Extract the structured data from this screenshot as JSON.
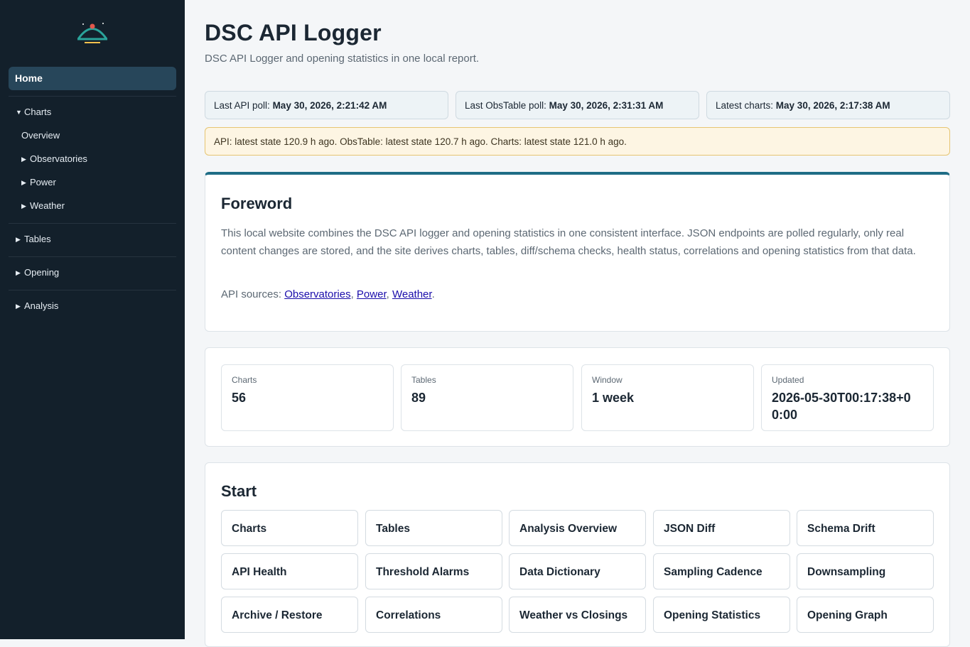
{
  "sidebar": {
    "home": "Home",
    "charts": "Charts",
    "overview": "Overview",
    "observatories": "Observatories",
    "power": "Power",
    "weather": "Weather",
    "tables": "Tables",
    "opening": "Opening",
    "analysis": "Analysis"
  },
  "header": {
    "title": "DSC API Logger",
    "subtitle": "DSC API Logger and opening statistics in one local report."
  },
  "polls": [
    {
      "label": "Last API poll: ",
      "value": "May 30, 2026, 2:21:42 AM"
    },
    {
      "label": "Last ObsTable poll: ",
      "value": "May 30, 2026, 2:31:31 AM"
    },
    {
      "label": "Latest charts: ",
      "value": "May 30, 2026, 2:17:38 AM"
    }
  ],
  "warning": "API: latest state 120.9 h ago. ObsTable: latest state 120.7 h ago. Charts: latest state 121.0 h ago.",
  "foreword": {
    "title": "Foreword",
    "text": "This local website combines the DSC API logger and opening statistics in one consistent interface. JSON endpoints are polled regularly, only real content changes are stored, and the site derives charts, tables, diff/schema checks, health status, correlations and opening statistics from that data.",
    "sources_label": "API sources: ",
    "links": [
      "Observatories",
      "Power",
      "Weather"
    ],
    "sep1": ", ",
    "sep2": ", ",
    "end": "."
  },
  "stats": [
    {
      "label": "Charts",
      "value": "56"
    },
    {
      "label": "Tables",
      "value": "89"
    },
    {
      "label": "Window",
      "value": "1 week"
    },
    {
      "label": "Updated",
      "value": "2026-05-30T00:17:38+00:00"
    }
  ],
  "start": {
    "title": "Start",
    "tiles": [
      "Charts",
      "Tables",
      "Analysis Overview",
      "JSON Diff",
      "Schema Drift",
      "API Health",
      "Threshold Alarms",
      "Data Dictionary",
      "Sampling Cadence",
      "Downsampling",
      "Archive / Restore",
      "Correlations",
      "Weather vs Closings",
      "Opening Statistics",
      "Opening Graph"
    ]
  },
  "colors": {
    "sidebar": "#13202b",
    "accent": "#1f6d86",
    "warning_bg": "#fdf5e3",
    "logo": "#2aa39a"
  },
  "icons": {
    "logo": "observatory-dome-icon",
    "collapse": "triangle-down-icon",
    "expand": "triangle-right-icon"
  }
}
